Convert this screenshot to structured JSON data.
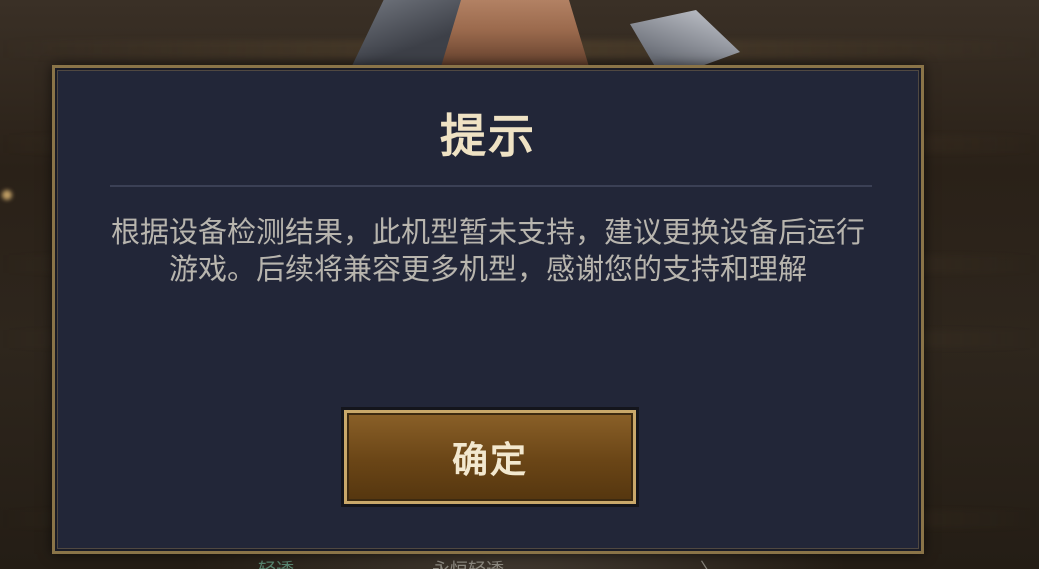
{
  "dialog": {
    "title": "提示",
    "message": "根据设备检测结果，此机型暂未支持，建议更换设备后运行游戏。后续将兼容更多机型，感谢您的支持和理解",
    "confirm_label": "确定"
  },
  "background": {
    "hint_left": "轻透",
    "hint_mid": "永恒轻透",
    "hint_arrow": "〉"
  },
  "colors": {
    "dialog_bg": "#222638",
    "border_gold": "#8a7448",
    "title": "#efe2c4",
    "message": "#b8b5ae",
    "button_fill": "#6a4516",
    "button_border": "#c9a86a"
  }
}
